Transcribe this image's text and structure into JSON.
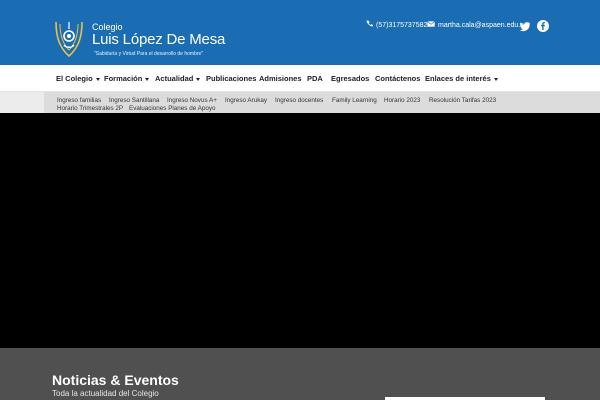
{
  "header": {
    "brand_small": "Colegio",
    "brand_name": "Luis López De Mesa",
    "tagline": "\"Sabiduría y Virtud Para el desarrollo de hombre\"",
    "phone": "(57)3175737582",
    "email": "martha.cala@aspaen.edu.co",
    "colors": {
      "header_bg": "#1a6db3",
      "hero_bg": "#000000",
      "news_bg": "#505050"
    },
    "icons": [
      "phone-icon",
      "email-icon",
      "twitter-icon",
      "facebook-icon",
      "school-logo"
    ]
  },
  "nav": {
    "items": [
      {
        "label": "El Colegio",
        "has_dropdown": true
      },
      {
        "label": "Formación",
        "has_dropdown": true
      },
      {
        "label": "Actualidad",
        "has_dropdown": true
      },
      {
        "label": "Publicaciones",
        "has_dropdown": false
      },
      {
        "label": "Admisiones",
        "has_dropdown": false
      },
      {
        "label": "PDA",
        "has_dropdown": false
      },
      {
        "label": "Egresados",
        "has_dropdown": false
      },
      {
        "label": "Contáctenos",
        "has_dropdown": false
      },
      {
        "label": "Enlaces de interés",
        "has_dropdown": true
      }
    ]
  },
  "subnav": {
    "items": [
      "Ingreso familias",
      "Ingreso Santillana",
      "Ingreso Novus A+",
      "Ingreso Arukay",
      "Ingreso docentes",
      "Family Learning",
      "Horario 2023",
      "Resolución Tarifas 2023",
      "Horario Trimestrales 2P",
      "Evaluaciones Planes de Apoyo"
    ]
  },
  "news": {
    "title": "Noticias & Eventos",
    "subtitle": "Toda la actualidad del Colegio"
  }
}
